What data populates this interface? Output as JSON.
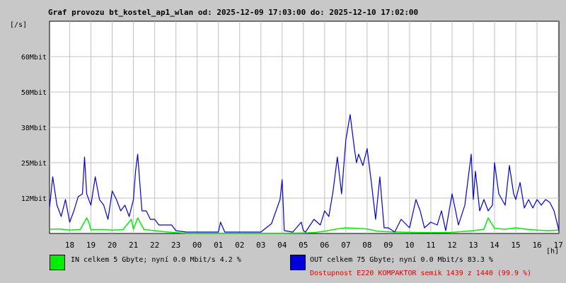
{
  "title": "Graf provozu bt_kostel_ap1_wlan od: 2025-12-09 17:03:00 do: 2025-12-10 17:02:00",
  "y_unit": "[/s]",
  "x_unit": "[h]",
  "colors": {
    "background": "#c8c8c8",
    "plot_bg": "#ffffff",
    "grid": "#c0c0c0",
    "in": "#00ee00",
    "out": "#0000dd",
    "status": "#e00000"
  },
  "legend": {
    "in_text": "IN celkem 5 Gbyte; nyní   0.0 Mbit/s 4.2 %",
    "out_text": "OUT celkem 75 Gbyte; nyní   0.0 Mbit/s 83.3 %"
  },
  "status_text": "Dostupnost E220 KOMPAKTOR semik 1439 z 1440 (99.9 %)",
  "chart_data": {
    "type": "line",
    "title": "Graf provozu bt_kostel_ap1_wlan od: 2025-12-09 17:03:00 do: 2025-12-10 17:02:00",
    "xlabel": "[h]",
    "ylabel": "[/s]",
    "x_ticks": [
      "18",
      "19",
      "20",
      "21",
      "22",
      "23",
      "00",
      "01",
      "02",
      "03",
      "04",
      "05",
      "06",
      "07",
      "08",
      "09",
      "10",
      "11",
      "12",
      "13",
      "14",
      "15",
      "16",
      "17"
    ],
    "y_ticks": [
      "12Mbit",
      "25Mbit",
      "38Mbit",
      "50Mbit",
      "60Mbit"
    ],
    "y_tick_values": [
      12.5,
      25,
      37.5,
      50,
      62.5
    ],
    "ylim": [
      0,
      75
    ],
    "xlim_hours": [
      17.05,
      41.03
    ],
    "grid": true,
    "series": [
      {
        "name": "IN",
        "color": "#00ee00",
        "x_hours": [
          17.05,
          17.5,
          18.0,
          18.5,
          18.8,
          18.9,
          19.0,
          19.5,
          20.0,
          20.5,
          20.9,
          21.0,
          21.2,
          21.5,
          22.0,
          22.5,
          23.0,
          23.5,
          24.0,
          25.0,
          26.0,
          27.0,
          28.0,
          29.0,
          29.5,
          30.0,
          30.5,
          31.0,
          31.5,
          32.0,
          32.5,
          33.0,
          33.5,
          34.0,
          35.0,
          36.0,
          37.0,
          37.5,
          37.7,
          38.0,
          38.5,
          39.0,
          39.5,
          40.0,
          40.5,
          41.03
        ],
        "values": [
          1.5,
          1.6,
          1.2,
          1.4,
          5.5,
          4.0,
          1.3,
          1.4,
          1.2,
          1.3,
          5.0,
          1.5,
          5.5,
          1.4,
          1.0,
          0.6,
          0.3,
          0.1,
          0.1,
          0.1,
          0.1,
          0.1,
          0.1,
          0.2,
          0.3,
          0.8,
          1.5,
          2.0,
          1.8,
          1.6,
          0.8,
          0.6,
          0.5,
          0.4,
          0.3,
          0.4,
          1.0,
          1.5,
          5.5,
          1.8,
          1.5,
          2.0,
          1.5,
          1.2,
          1.0,
          1.2
        ]
      },
      {
        "name": "OUT",
        "color": "#0000dd",
        "x_hours": [
          17.05,
          17.2,
          17.4,
          17.6,
          17.8,
          18.0,
          18.2,
          18.4,
          18.6,
          18.7,
          18.8,
          19.0,
          19.2,
          19.4,
          19.6,
          19.8,
          20.0,
          20.2,
          20.4,
          20.6,
          20.8,
          21.0,
          21.1,
          21.2,
          21.4,
          21.6,
          21.8,
          22.0,
          22.2,
          22.5,
          22.8,
          23.0,
          23.5,
          24.0,
          24.5,
          25.0,
          25.1,
          25.3,
          25.6,
          26.0,
          26.5,
          27.0,
          27.5,
          27.9,
          28.0,
          28.1,
          28.5,
          28.9,
          29.0,
          29.1,
          29.5,
          29.8,
          30.0,
          30.2,
          30.4,
          30.6,
          30.8,
          31.0,
          31.2,
          31.4,
          31.5,
          31.6,
          31.8,
          32.0,
          32.2,
          32.4,
          32.6,
          32.8,
          33.0,
          33.3,
          33.6,
          34.0,
          34.3,
          34.5,
          34.7,
          35.0,
          35.3,
          35.5,
          35.7,
          36.0,
          36.3,
          36.6,
          36.9,
          37.0,
          37.1,
          37.3,
          37.5,
          37.7,
          37.9,
          38.0,
          38.2,
          38.5,
          38.7,
          38.9,
          39.0,
          39.2,
          39.4,
          39.6,
          39.8,
          40.0,
          40.2,
          40.4,
          40.6,
          40.8,
          41.03
        ],
        "values": [
          9,
          20,
          10,
          6,
          12,
          4,
          8,
          13,
          14,
          27,
          14,
          10,
          20,
          12,
          10,
          5,
          15,
          12,
          8,
          10,
          6,
          12,
          22,
          28,
          8,
          8,
          5,
          5,
          3,
          3,
          3,
          1,
          0.5,
          0.5,
          0.5,
          0.5,
          4,
          0.5,
          0.5,
          0.5,
          0.5,
          0.5,
          3.5,
          12,
          19,
          1,
          0.5,
          4,
          1,
          0.5,
          5,
          3,
          8,
          6,
          15,
          27,
          14,
          33,
          42,
          30,
          25,
          28,
          24,
          30,
          18,
          5,
          20,
          2,
          2,
          0.5,
          5,
          2,
          12,
          8,
          2,
          4,
          3,
          8,
          1,
          14,
          3,
          10,
          28,
          12,
          22,
          8,
          12,
          8,
          10,
          25,
          14,
          10,
          24,
          14,
          12,
          18,
          9,
          12,
          9,
          12,
          10,
          12,
          11,
          8,
          1
        ]
      }
    ]
  }
}
